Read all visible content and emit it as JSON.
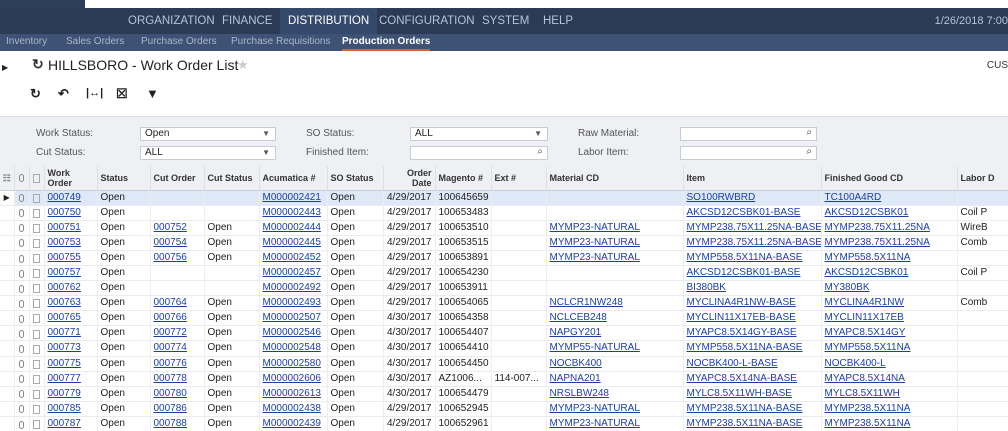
{
  "main_nav": {
    "items": [
      {
        "label": "ORGANIZATION",
        "active": false
      },
      {
        "label": "FINANCE",
        "active": false
      },
      {
        "label": "DISTRIBUTION",
        "active": true
      },
      {
        "label": "CONFIGURATION",
        "active": false
      },
      {
        "label": "SYSTEM",
        "active": false
      },
      {
        "label": "HELP",
        "active": false
      }
    ],
    "datetime": "1/26/2018  7:00"
  },
  "sub_nav": {
    "items": [
      {
        "label": "Inventory",
        "active": false
      },
      {
        "label": "Sales Orders",
        "active": false
      },
      {
        "label": "Purchase Orders",
        "active": false
      },
      {
        "label": "Purchase Requisitions",
        "active": false
      },
      {
        "label": "Production Orders",
        "active": true
      }
    ]
  },
  "title": {
    "text": "HILLSBORO - Work Order List",
    "right_label": "CUS"
  },
  "toolbar": {
    "icons": [
      "refresh-icon",
      "undo-icon",
      "fit-columns-icon",
      "export-excel-icon",
      "filter-icon"
    ]
  },
  "filters": {
    "work_status_label": "Work Status:",
    "work_status_value": "Open",
    "cut_status_label": "Cut Status:",
    "cut_status_value": "ALL",
    "so_status_label": "SO Status:",
    "so_status_value": "ALL",
    "finished_item_label": "Finished Item:",
    "finished_item_value": "",
    "raw_material_label": "Raw Material:",
    "raw_material_value": "",
    "labor_item_label": "Labor Item:",
    "labor_item_value": ""
  },
  "grid": {
    "columns": [
      "Work Order",
      "Status",
      "Cut Order",
      "Cut Status",
      "Acumatica #",
      "SO Status",
      "Order Date",
      "Magento #",
      "Ext #",
      "Material CD",
      "Item",
      "Finished Good CD",
      "Labor D"
    ],
    "rows": [
      [
        "000749",
        "Open",
        "",
        "",
        "M000002421",
        "Open",
        "4/29/2017",
        "100645659",
        "",
        "",
        "SO100RWBRD",
        "TC100A4RD",
        ""
      ],
      [
        "000750",
        "Open",
        "",
        "",
        "M000002443",
        "Open",
        "4/29/2017",
        "100653483",
        "",
        "",
        "AKCSD12CSBK01-BASE",
        "AKCSD12CSBK01",
        "Coil P"
      ],
      [
        "000751",
        "Open",
        "000752",
        "Open",
        "M000002444",
        "Open",
        "4/29/2017",
        "100653510",
        "",
        "MYMP23-NATURAL",
        "MYMP238.75X11.25NA-BASE",
        "MYMP238.75X11.25NA",
        "WireB"
      ],
      [
        "000753",
        "Open",
        "000754",
        "Open",
        "M000002445",
        "Open",
        "4/29/2017",
        "100653515",
        "",
        "MYMP23-NATURAL",
        "MYMP238.75X11.25NA-BASE",
        "MYMP238.75X11.25NA",
        "Comb"
      ],
      [
        "000755",
        "Open",
        "000756",
        "Open",
        "M000002452",
        "Open",
        "4/29/2017",
        "100653891",
        "",
        "MYMP23-NATURAL",
        "MYMP558.5X11NA-BASE",
        "MYMP558.5X11NA",
        ""
      ],
      [
        "000757",
        "Open",
        "",
        "",
        "M000002457",
        "Open",
        "4/29/2017",
        "100654230",
        "",
        "",
        "AKCSD12CSBK01-BASE",
        "AKCSD12CSBK01",
        "Coil P"
      ],
      [
        "000762",
        "Open",
        "",
        "",
        "M000002492",
        "Open",
        "4/29/2017",
        "100653911",
        "",
        "",
        "BI380BK",
        "MY380BK",
        ""
      ],
      [
        "000763",
        "Open",
        "000764",
        "Open",
        "M000002493",
        "Open",
        "4/29/2017",
        "100654065",
        "",
        "NCLCR1NW248",
        "MYCLINA4R1NW-BASE",
        "MYCLINA4R1NW",
        "Comb"
      ],
      [
        "000765",
        "Open",
        "000766",
        "Open",
        "M000002507",
        "Open",
        "4/30/2017",
        "100654358",
        "",
        "NCLCEB248",
        "MYCLIN11X17EB-BASE",
        "MYCLIN11X17EB",
        ""
      ],
      [
        "000771",
        "Open",
        "000772",
        "Open",
        "M000002546",
        "Open",
        "4/30/2017",
        "100654407",
        "",
        "NAPGY201",
        "MYAPC8.5X14GY-BASE",
        "MYAPC8.5X14GY",
        ""
      ],
      [
        "000773",
        "Open",
        "000774",
        "Open",
        "M000002548",
        "Open",
        "4/30/2017",
        "100654410",
        "",
        "MYMP55-NATURAL",
        "MYMP558.5X11NA-BASE",
        "MYMP558.5X11NA",
        ""
      ],
      [
        "000775",
        "Open",
        "000776",
        "Open",
        "M000002580",
        "Open",
        "4/30/2017",
        "100654450",
        "",
        "NOCBK400",
        "NOCBK400-L-BASE",
        "NOCBK400-L",
        ""
      ],
      [
        "000777",
        "Open",
        "000778",
        "Open",
        "M000002606",
        "Open",
        "4/30/2017",
        "AZ1006...",
        "114-007...",
        "NAPNA201",
        "MYAPC8.5X14NA-BASE",
        "MYAPC8.5X14NA",
        ""
      ],
      [
        "000779",
        "Open",
        "000780",
        "Open",
        "M000002613",
        "Open",
        "4/30/2017",
        "100654479",
        "",
        "NRSLBW248",
        "MYLC8.5X11WH-BASE",
        "MYLC8.5X11WH",
        ""
      ],
      [
        "000785",
        "Open",
        "000786",
        "Open",
        "M000002438",
        "Open",
        "4/29/2017",
        "100652945",
        "",
        "MYMP23-NATURAL",
        "MYMP238.5X11NA-BASE",
        "MYMP238.5X11NA",
        ""
      ],
      [
        "000787",
        "Open",
        "000788",
        "Open",
        "M000002439",
        "Open",
        "4/29/2017",
        "100652961",
        "",
        "MYMP23-NATURAL",
        "MYMP238.5X11NA-BASE",
        "MYMP238.5X11NA",
        ""
      ]
    ],
    "selected_row": 0
  }
}
